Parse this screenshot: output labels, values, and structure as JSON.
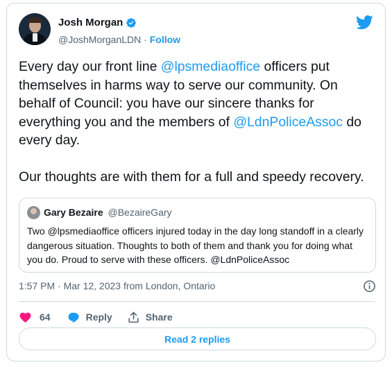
{
  "author": {
    "display_name": "Josh Morgan",
    "handle": "@JoshMorganLDN",
    "separator": "·",
    "follow_label": "Follow",
    "verified": true
  },
  "tweet": {
    "segments": [
      {
        "text": "Every day our front line ",
        "mention": false
      },
      {
        "text": "@lpsmediaoffice",
        "mention": true
      },
      {
        "text": " officers put themselves in harms way to serve our community.  On behalf of Council: you have our sincere thanks for everything you and the members of ",
        "mention": false
      },
      {
        "text": "@LdnPoliceAssoc",
        "mention": true
      },
      {
        "text": " do every day.\n\nOur thoughts are with them for a full and speedy recovery.",
        "mention": false
      }
    ]
  },
  "quoted": {
    "display_name": "Gary Bezaire",
    "handle": "@BezaireGary",
    "text": "Two @lpsmediaoffice officers  injured today in the day long standoff in a clearly dangerous situation.  Thoughts to both of them and thank you for doing what you do.  Proud to serve with these officers.  @LdnPoliceAssoc"
  },
  "meta": {
    "timestamp": "1:57 PM · Mar 12, 2023 from London, Ontario"
  },
  "actions": {
    "like_count": "64",
    "reply_label": "Reply",
    "share_label": "Share"
  },
  "replies_button": "Read 2 replies",
  "colors": {
    "accent": "#1d9bf0",
    "like": "#f91880",
    "text": "#0f1419",
    "muted": "#536471",
    "border": "#cfd9de"
  },
  "icons": [
    "verified-badge-icon",
    "twitter-bird-icon",
    "info-icon",
    "heart-icon",
    "reply-bubble-icon",
    "share-icon"
  ]
}
